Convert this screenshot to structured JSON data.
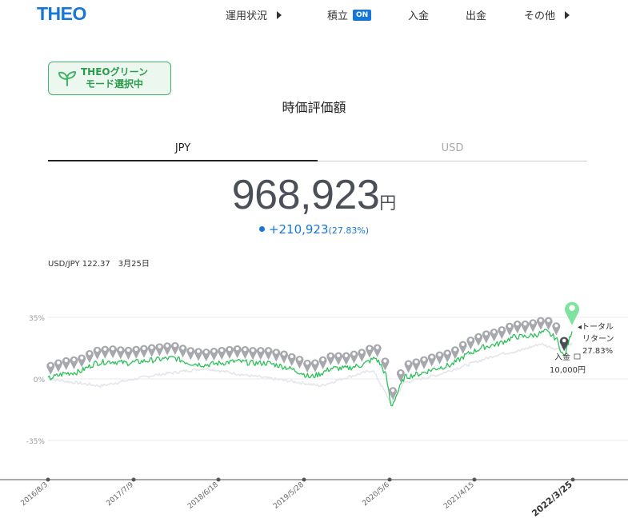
{
  "header": {
    "logo": "THEO",
    "nav": [
      {
        "label": "運用状況"
      },
      {
        "label": "積立",
        "badge": "ON"
      },
      {
        "label": "入金"
      },
      {
        "label": "出金"
      },
      {
        "label": "その他"
      }
    ]
  },
  "green_mode": {
    "line1": "THEOグリーン",
    "line2": "モード選択中",
    "icon": "leaf-icon"
  },
  "page_title": "時価評価額",
  "tabs": {
    "jpy": "JPY",
    "usd": "USD"
  },
  "valuation": {
    "amount": "968,923",
    "unit": "円",
    "change": "+210,923",
    "change_pct": "(27.83%)"
  },
  "fx": {
    "label": "USD/JPY 122.37",
    "date": "3月25日"
  },
  "colors": {
    "accent": "#1777d8",
    "green": "#2ec05a",
    "marker_gray": "#a6a8ad",
    "pin_green": "#7fe3a0"
  },
  "chart_data": {
    "type": "line",
    "x_ticks": [
      "2016/8/3",
      "2017/7/9",
      "2018/6/18",
      "2019/5/28",
      "2020/5/6",
      "2021/4/15",
      "2022/3/25"
    ],
    "y_ticks": [
      "35%",
      "0%",
      "-35%"
    ],
    "ylim": [
      -55,
      38
    ],
    "grid": true,
    "series": [
      {
        "color": "#2ec05a",
        "x": [
          0,
          0.03,
          0.06,
          0.09,
          0.12,
          0.15,
          0.18,
          0.21,
          0.24,
          0.27,
          0.3,
          0.33,
          0.36,
          0.39,
          0.42,
          0.45,
          0.48,
          0.5,
          0.52,
          0.54,
          0.57,
          0.6,
          0.625,
          0.635,
          0.645,
          0.655,
          0.68,
          0.71,
          0.74,
          0.77,
          0.8,
          0.83,
          0.86,
          0.89,
          0.91,
          0.93,
          0.95,
          0.97,
          0.985,
          1.0
        ],
        "y": [
          0,
          3,
          4,
          9,
          10,
          9,
          10,
          11,
          12,
          9,
          8,
          9,
          10,
          9,
          9,
          7,
          4,
          1,
          3,
          6,
          6,
          8,
          12,
          8,
          2,
          -16,
          1,
          3,
          6,
          8,
          14,
          18,
          20,
          24,
          24,
          25,
          27,
          23,
          12,
          27.8
        ]
      },
      {
        "color": "#e4e6eb",
        "x": [
          0,
          0.05,
          0.1,
          0.2,
          0.3,
          0.38,
          0.48,
          0.52,
          0.56,
          0.62,
          0.655,
          0.68,
          0.74,
          0.8,
          0.86,
          0.9,
          0.94,
          0.97,
          1.0
        ],
        "y": [
          0,
          -2,
          -4,
          2,
          6,
          2,
          -2,
          -4,
          0,
          5,
          -14,
          -2,
          2,
          8,
          14,
          16,
          20,
          17,
          20
        ]
      }
    ],
    "annotations": [
      {
        "label": "トータル",
        "sub": "リターン",
        "value": "27.83%"
      },
      {
        "label": "入金",
        "value": "10,000円"
      }
    ]
  }
}
